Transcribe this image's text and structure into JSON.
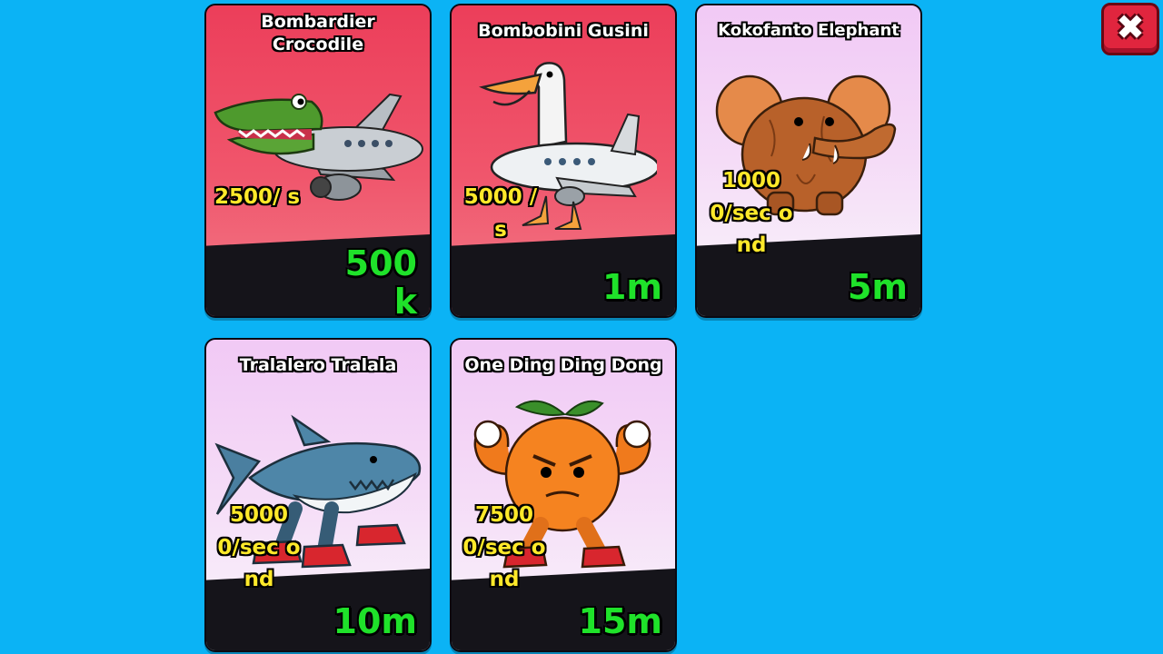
{
  "cards": [
    {
      "name": "Bombardier Crocodile",
      "rate": "2500/ s",
      "price": "500 k",
      "icon": "crocodile-plane-icon"
    },
    {
      "name": "Bombobini Gusini",
      "rate": "5000 /s",
      "price": "1m",
      "icon": "goose-plane-icon"
    },
    {
      "name": "Kokofanto Elephant",
      "rate": "1000 0/sec ond",
      "price": "5m",
      "icon": "coconut-elephant-icon"
    },
    {
      "name": "Tralalero Tralala",
      "rate": "5000 0/sec ond",
      "price": "10m",
      "icon": "shark-sneakers-icon"
    },
    {
      "name": "One Ding Ding Dong",
      "rate": "7500 0/sec ond",
      "price": "15m",
      "icon": "muscle-orange-icon"
    }
  ],
  "close_button": {
    "icon": "close-icon",
    "glyph": "✖"
  },
  "colors": {
    "background": "#0bb3f5",
    "price": "#1fe22a",
    "rate": "#ffe92a",
    "close": "#e0253e"
  }
}
